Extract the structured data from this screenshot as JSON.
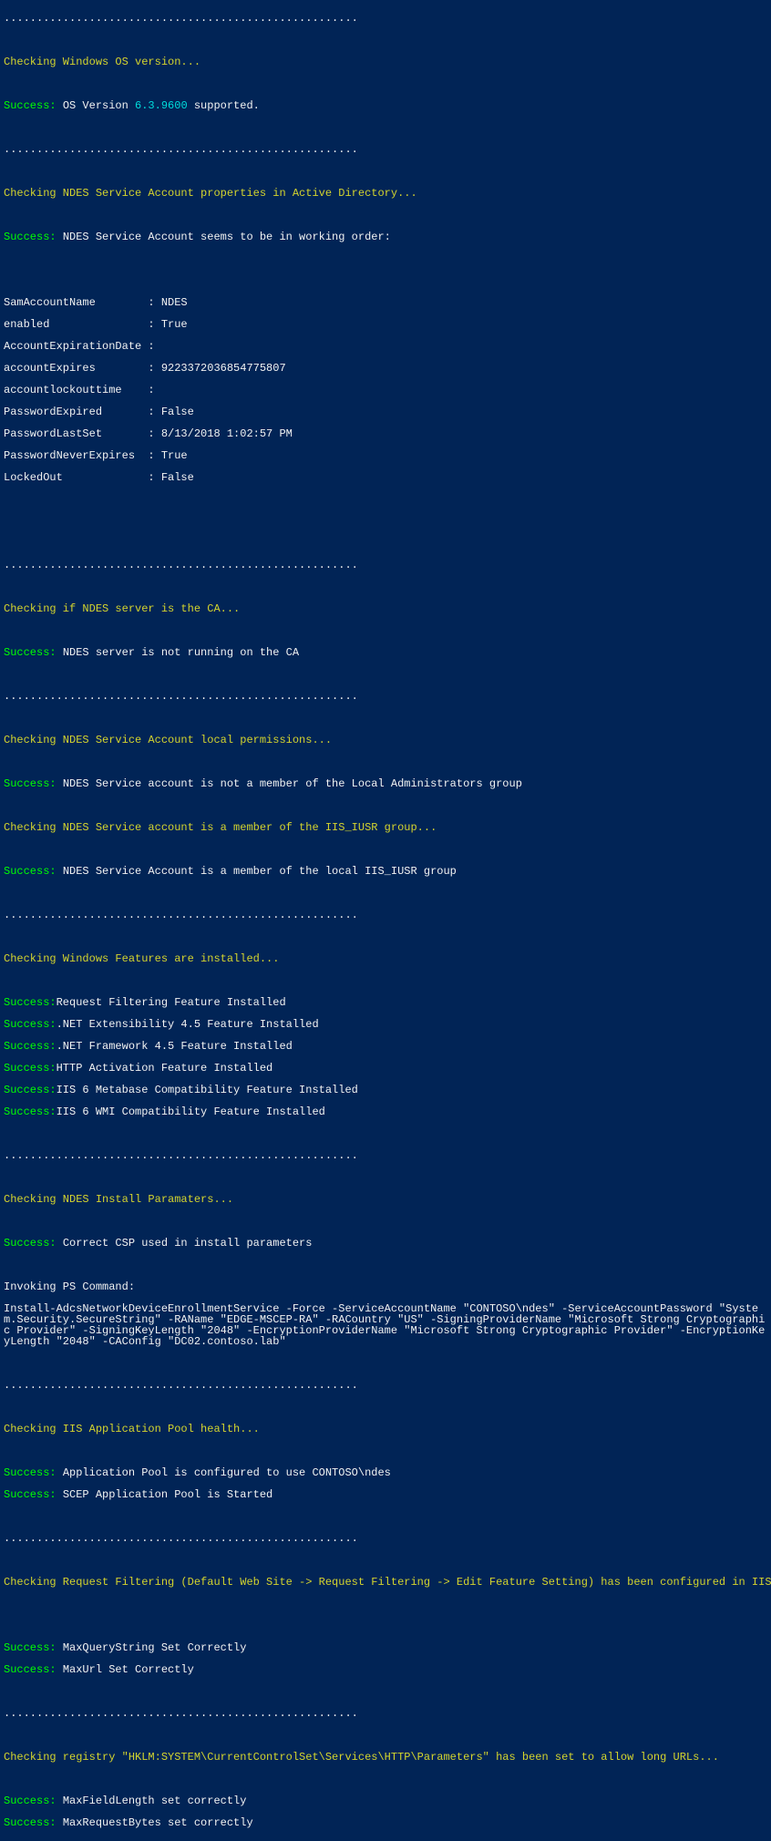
{
  "dots": "......................................................",
  "checks": {
    "os": {
      "header": "Checking Windows OS version...",
      "success_label": "Success: ",
      "msg1": "OS Version ",
      "version": "6.3.9600",
      "msg2": " supported."
    },
    "ad": {
      "header": "Checking NDES Service Account properties in Active Directory...",
      "success_label": "Success: ",
      "msg": "NDES Service Account seems to be in working order:",
      "props": [
        "SamAccountName        : NDES",
        "enabled               : True",
        "AccountExpirationDate :",
        "accountExpires        : 9223372036854775807",
        "accountlockouttime    :",
        "PasswordExpired       : False",
        "PasswordLastSet       : 8/13/2018 1:02:57 PM",
        "PasswordNeverExpires  : True",
        "LockedOut             : False"
      ]
    },
    "ca": {
      "header": "Checking if NDES server is the CA...",
      "success_label": "Success: ",
      "msg": "NDES server is not running on the CA"
    },
    "localperm": {
      "header": "Checking NDES Service Account local permissions...",
      "success_label": "Success: ",
      "msg": "NDES Service account is not a member of the Local Administrators group"
    },
    "iisiusr": {
      "header": "Checking NDES Service account is a member of the IIS_IUSR group...",
      "success_label": "Success: ",
      "msg": "NDES Service Account is a member of the local IIS_IUSR group"
    },
    "features": {
      "header": "Checking Windows Features are installed...",
      "success_label": "Success:",
      "items": [
        "Request Filtering Feature Installed",
        ".NET Extensibility 4.5 Feature Installed",
        ".NET Framework 4.5 Feature Installed",
        "HTTP Activation Feature Installed",
        "IIS 6 Metabase Compatibility Feature Installed",
        "IIS 6 WMI Compatibility Feature Installed"
      ]
    },
    "install": {
      "header": "Checking NDES Install Paramaters...",
      "success_label": "Success: ",
      "msg": "Correct CSP used in install parameters",
      "invoke": "Invoking PS Command:",
      "cmd": "Install-AdcsNetworkDeviceEnrollmentService -Force -ServiceAccountName \"CONTOSO\\ndes\" -ServiceAccountPassword \"System.Security.SecureString\" -RAName \"EDGE-MSCEP-RA\" -RACountry \"US\" -SigningProviderName \"Microsoft Strong Cryptographic Provider\" -SigningKeyLength \"2048\" -EncryptionProviderName \"Microsoft Strong Cryptographic Provider\" -EncryptionKeyLength \"2048\" -CAConfig \"DC02.contoso.lab\""
    },
    "apppool": {
      "header": "Checking IIS Application Pool health...",
      "success_label": "Success: ",
      "msg1": "Application Pool is configured to use CONTOSO\\ndes",
      "msg2": "SCEP Application Pool is Started"
    },
    "reqfilter": {
      "header": "Checking Request Filtering (Default Web Site -> Request Filtering -> Edit Feature Setting) has been configured in IIS...",
      "success_label": "Success: ",
      "msg1": "MaxQueryString Set Correctly",
      "msg2": "MaxUrl Set Correctly"
    },
    "registry": {
      "header": "Checking registry \"HKLM:SYSTEM\\CurrentControlSet\\Services\\HTTP\\Parameters\" has been set to allow long URLs...",
      "success_label": "Success: ",
      "msg1": "MaxFieldLength set correctly",
      "msg2": "MaxRequestBytes set correctly"
    }
  }
}
